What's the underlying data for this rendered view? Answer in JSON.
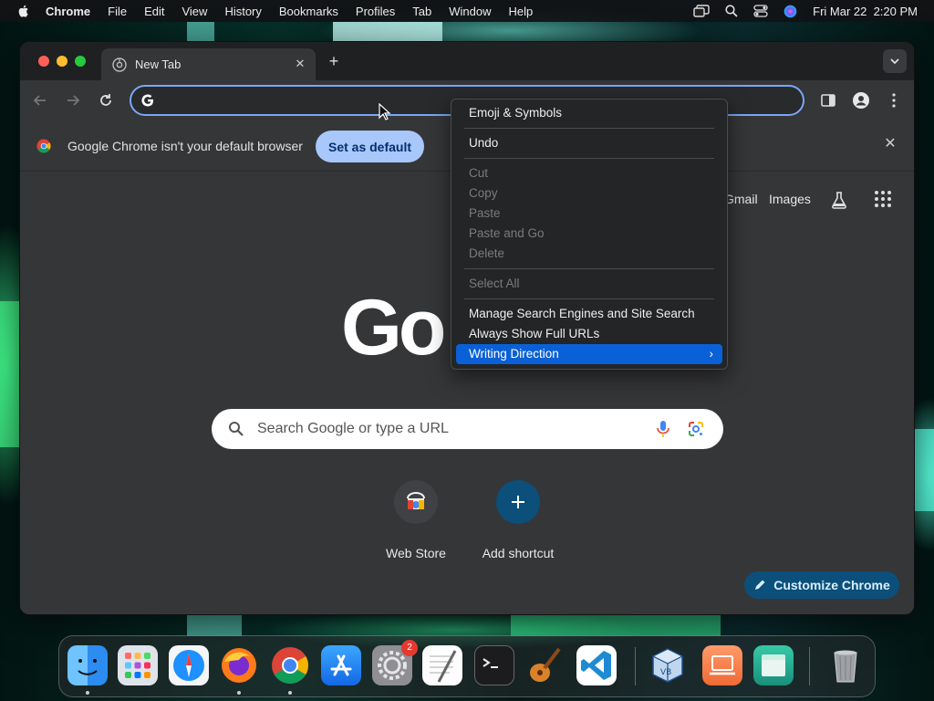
{
  "menubar": {
    "app": "Chrome",
    "items": [
      "File",
      "Edit",
      "View",
      "History",
      "Bookmarks",
      "Profiles",
      "Tab",
      "Window",
      "Help"
    ],
    "datetime": "Fri Mar 22  2:20 PM"
  },
  "window": {
    "tab_title": "New Tab",
    "omnibox_value": ""
  },
  "infobar": {
    "message": "Google Chrome isn't your default browser",
    "button": "Set as default"
  },
  "ntp": {
    "links": [
      "Gmail",
      "Images"
    ],
    "logo": "Go",
    "search_placeholder": "Search Google or type a URL",
    "shortcuts": [
      "Web Store",
      "Add shortcut"
    ],
    "customize": "Customize Chrome"
  },
  "context_menu": {
    "items": [
      {
        "label": "Emoji & Symbols",
        "enabled": true
      },
      {
        "label": "Undo",
        "enabled": true
      },
      {
        "label": "Cut",
        "enabled": false
      },
      {
        "label": "Copy",
        "enabled": false
      },
      {
        "label": "Paste",
        "enabled": false
      },
      {
        "label": "Paste and Go",
        "enabled": false
      },
      {
        "label": "Delete",
        "enabled": false
      },
      {
        "label": "Select All",
        "enabled": false
      },
      {
        "label": "Manage Search Engines and Site Search",
        "enabled": true
      },
      {
        "label": "Always Show Full URLs",
        "enabled": true
      },
      {
        "label": "Writing Direction",
        "enabled": true,
        "highlighted": true,
        "submenu": true
      }
    ]
  },
  "dock": {
    "apps": [
      "finder-icon",
      "launchpad-icon",
      "safari-icon",
      "firefox-icon",
      "chrome-icon",
      "app-store-icon",
      "system-settings-icon",
      "textedit-icon",
      "terminal-icon",
      "garageband-icon",
      "vscode-icon",
      "virtualbox-icon",
      "laptop-app-icon",
      "folder-app-icon",
      "trash-icon"
    ],
    "settings_badge": "2"
  },
  "colors": {
    "accent": "#a8c7fa",
    "menu_highlight": "#0a60d6",
    "window_bg": "#353638"
  }
}
